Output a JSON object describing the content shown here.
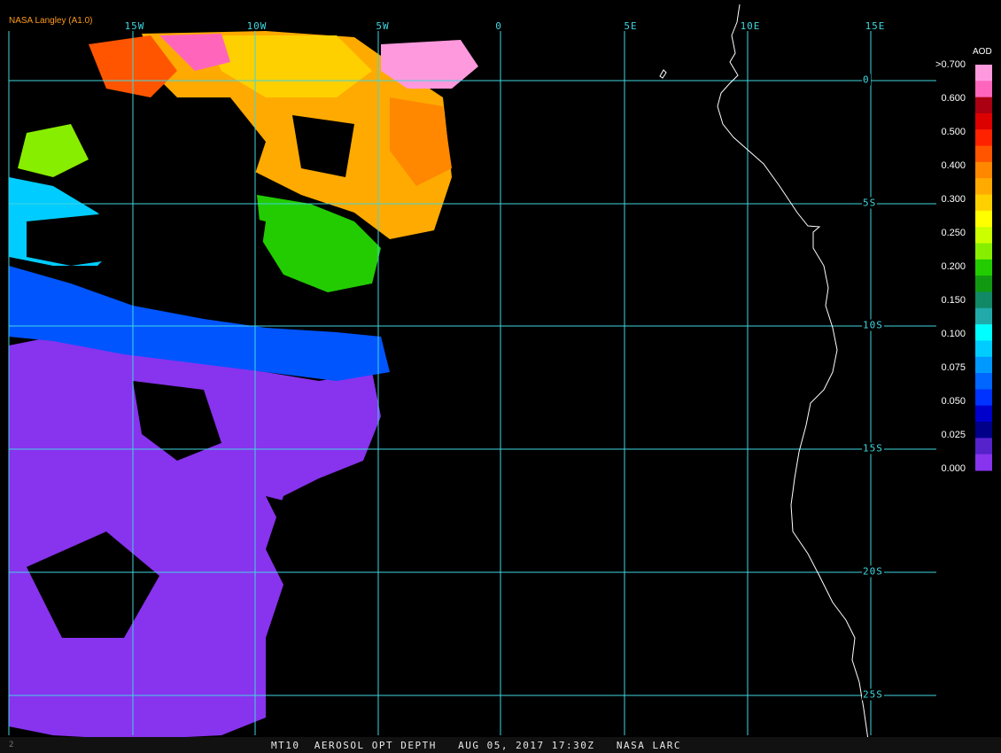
{
  "header": {
    "brand": "NASA Langley (A1.0)"
  },
  "map": {
    "longitude_labels": [
      "15W",
      "10W",
      "5W",
      "0",
      "5E",
      "10E",
      "15E"
    ],
    "latitude_labels": [
      "0",
      "5S",
      "10S",
      "15S",
      "20S",
      "25S"
    ],
    "grid_color": "#3fd6e0",
    "coastline_color": "#ffffff",
    "background_color": "#000000"
  },
  "legend": {
    "title": "AOD",
    "ticks": [
      ">0.700",
      "0.600",
      "0.500",
      "0.400",
      "0.300",
      "0.250",
      "0.200",
      "0.150",
      "0.100",
      "0.075",
      "0.050",
      "0.025",
      "0.000"
    ],
    "colors": [
      "#ff99dd",
      "#ff66bb",
      "#aa0011",
      "#dd0000",
      "#ff2200",
      "#ff5500",
      "#ff8800",
      "#ffaa00",
      "#ffd000",
      "#ffff00",
      "#ccff00",
      "#88ee00",
      "#22cc00",
      "#119911",
      "#118866",
      "#22aaaa",
      "#00ffff",
      "#00ccff",
      "#0099ff",
      "#0066ff",
      "#0033ff",
      "#0000cc",
      "#000088",
      "#5522cc",
      "#8833ee"
    ]
  },
  "footer": {
    "text": "MT10  AEROSOL OPT DEPTH   AUG 05, 2017 17:30Z   NASA LARC"
  }
}
